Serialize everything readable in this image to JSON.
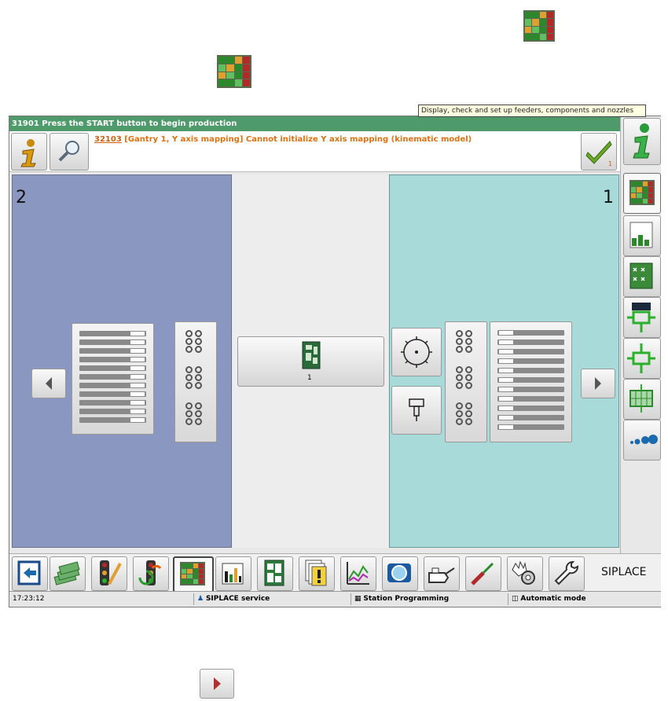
{
  "status_message": "31901 Press the START button to begin production",
  "message": {
    "code": "32103",
    "text": "[Gantry 1, Y axis mapping] Cannot initialize Y axis mapping (kinematic model)",
    "ack_count": "1"
  },
  "panels": {
    "left_number": "2",
    "right_number": "1",
    "center_count": "1"
  },
  "tooltip": "Display, check and set up feeders, components and nozzles",
  "toolbar": {
    "brand": "SIPLACE"
  },
  "footer": {
    "time": "17:23:12",
    "user": "SIPLACE service",
    "mode_location": "Station Programming",
    "mode": "Automatic mode"
  },
  "colors": {
    "status_green": "#4f9a6a",
    "left_panel": "#8a97c0",
    "right_panel": "#a9dada",
    "message_orange": "#e07010"
  }
}
